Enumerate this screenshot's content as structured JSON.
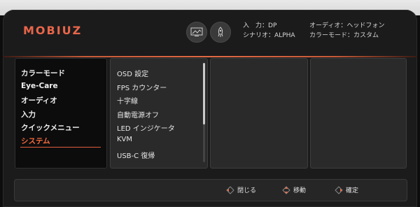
{
  "brand": "MOBIUZ",
  "header": {
    "input_label": "入　力",
    "input_value": "DP",
    "scenario_label": "シナリオ",
    "scenario_value": "ALPHA",
    "audio_label": "オーディオ",
    "audio_value": "ヘッドフォン",
    "colormode_label": "カラーモード",
    "colormode_value": "カスタム",
    "icons": [
      "display-mode-icon",
      "rocket-icon"
    ]
  },
  "sidebar": {
    "items": [
      {
        "label": "カラーモード"
      },
      {
        "label": "Eye-Care"
      },
      {
        "label": "オーディオ"
      },
      {
        "label": "入力"
      },
      {
        "label": "クイックメニュー"
      },
      {
        "label": "システム"
      }
    ],
    "active_index": 5
  },
  "submenu": {
    "items": [
      {
        "label": "OSD 設定"
      },
      {
        "label": "FPS カウンター"
      },
      {
        "label": "十字線"
      },
      {
        "label": "自動電源オフ"
      },
      {
        "label": "LED インジケータ"
      },
      {
        "label": "KVM"
      },
      {
        "label": "USB-C 復帰"
      }
    ]
  },
  "footer": {
    "close_label": "閉じる",
    "move_label": "移動",
    "confirm_label": "確定"
  },
  "colors": {
    "accent": "#e8664a",
    "active": "#f36a3c"
  }
}
